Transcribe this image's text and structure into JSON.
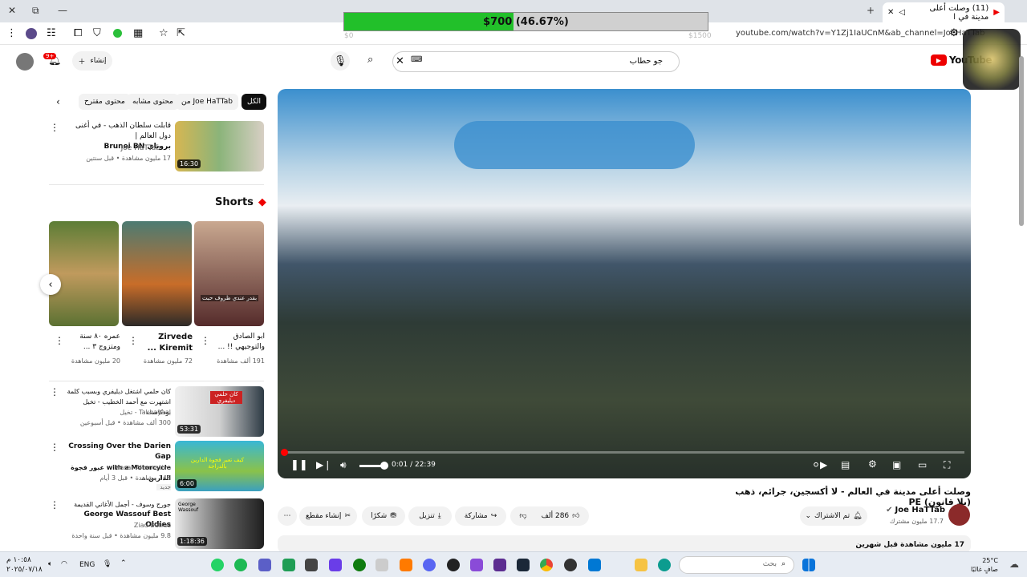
{
  "browser": {
    "tab_title": "(11) وصلت أعلى مدينة في ا",
    "url": "youtube.com/watch?v=Y1Zj1IaUCnM&ab_channel=JoeHaTTab"
  },
  "overlay": {
    "text": "$700 (46.67%)",
    "progress": 0.4667,
    "min_label": "$0",
    "max_label": "$1500"
  },
  "header": {
    "logo_text": "YouTube",
    "search_value": "جو حطاب",
    "create_label": "إنشاء",
    "notif_badge": "9+"
  },
  "chips": [
    "الكل",
    "من Joe HaTTab",
    "محتوى مشابه",
    "محتوى مقترح"
  ],
  "top_related": {
    "title_line1": "قابلت سلطان الذهب - في أغنى دول العالم |",
    "title_line2": "بروناي Brunei BN",
    "channel": "Joe HaTTab",
    "meta": "17 مليون مشاهدة • قبل سنتين",
    "duration": "16:30"
  },
  "shorts": {
    "heading": "Shorts",
    "items": [
      {
        "title1": "ابو الصادق",
        "title2": "والتوجيهي !! ...",
        "views": "191 ألف مشاهدة",
        "caption": "بقدر عندي ظروف حبت"
      },
      {
        "title1": "Zirvede",
        "title2": "Kiremit ...",
        "views": "72 مليون مشاهدة"
      },
      {
        "title1": "عمره ٨٠ سنة",
        "title2": "ومتزوج ٣ ...",
        "views": "20 مليون مشاهدة"
      }
    ]
  },
  "related": [
    {
      "title1": "كان حلمي اشتغل ديليفري وبسبب كلمة",
      "title2": "اشتهرت مع أحمد الخطيب - تخيل بودكاست",
      "channel": "Takhayaal - تخيل",
      "meta": "300 ألف مشاهدة • قبل أسبوعين",
      "duration": "53:31",
      "thumb_text": "كان حلمي ديليفري"
    },
    {
      "title1": "Crossing Over the Darien Gap",
      "title2": "with a Motorcycle عبور فجوة الدارين...",
      "channel": "Masar Alternativo",
      "meta": "146 مشاهدة • قبل 3 أيام",
      "badge": "جديد",
      "duration": "6:00",
      "thumb_text": "كيف تعبر فجوة الدارين بالدراجة"
    },
    {
      "title1": "جورج وسوف - أجمل الأغاني القديمة",
      "title2": "George Wassouf Best Oldies",
      "channel": "Ziad Butros",
      "meta": "9.8 مليون مشاهدة • قبل سنة واحدة",
      "duration": "1:18:36",
      "thumb_text": "George Wassouf"
    }
  ],
  "player": {
    "time": "0:01 / 22:39"
  },
  "video": {
    "title": "وصلت أعلى مدينة في العالم - لا أكسجين، جرائم، ذهب (بلا قانون) PE",
    "channel": "Joe HaTTab",
    "subs": "17.7 مليون مشترك",
    "subscribed": "تم الاشتراك",
    "likes": "286 ألف",
    "share": "مشاركة",
    "download": "تنزيل",
    "thanks": "شكرًا",
    "clip": "إنشاء مقطع",
    "views_line": "17 مليون مشاهدة  قبل شهرين"
  },
  "taskbar": {
    "lang": "ENG",
    "time": "١٠:٥٨ م",
    "date": "٢٠٢٥/٠٧/١٨",
    "search_placeholder": "بحث",
    "weather_temp": "25°C",
    "weather_desc": "صافٍ غالبًا"
  }
}
